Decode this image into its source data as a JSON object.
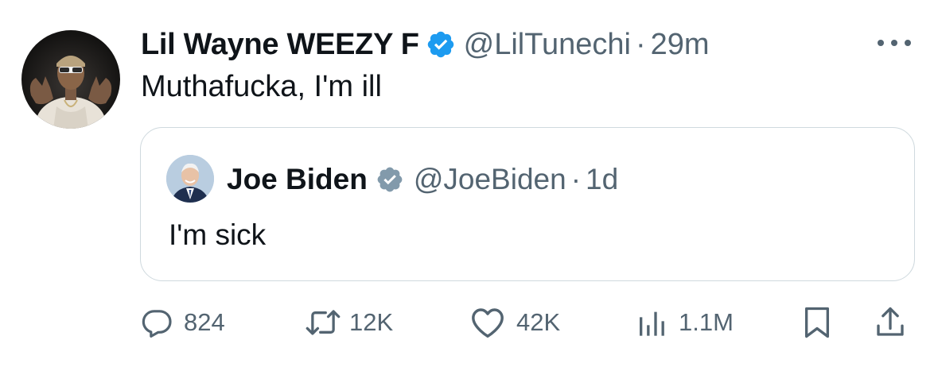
{
  "tweet": {
    "display_name": "Lil Wayne WEEZY F",
    "handle": "@LilTunechi",
    "separator": "·",
    "time": "29m",
    "text": "Muthafucka, I'm ill",
    "avatar_icon": "user-avatar-icon",
    "verified_icon": "verified-badge-icon",
    "verified_color": "#1d9bf0",
    "more_icon": "more-options-icon"
  },
  "quoted_tweet": {
    "display_name": "Joe Biden",
    "handle": "@JoeBiden",
    "separator": "·",
    "time": "1d",
    "text": "I'm sick",
    "verified_icon": "government-verified-badge-icon",
    "verified_color": "#829aab"
  },
  "actions": {
    "reply": {
      "icon": "reply-icon",
      "count": "824"
    },
    "retweet": {
      "icon": "retweet-icon",
      "count": "12K"
    },
    "like": {
      "icon": "heart-icon",
      "count": "42K"
    },
    "views": {
      "icon": "views-bar-chart-icon",
      "count": "1.1M"
    },
    "bookmark": {
      "icon": "bookmark-icon"
    },
    "share": {
      "icon": "share-icon"
    }
  },
  "colors": {
    "text_primary": "#0f1419",
    "text_secondary": "#536471",
    "border": "#cfd9de",
    "accent": "#1d9bf0"
  }
}
